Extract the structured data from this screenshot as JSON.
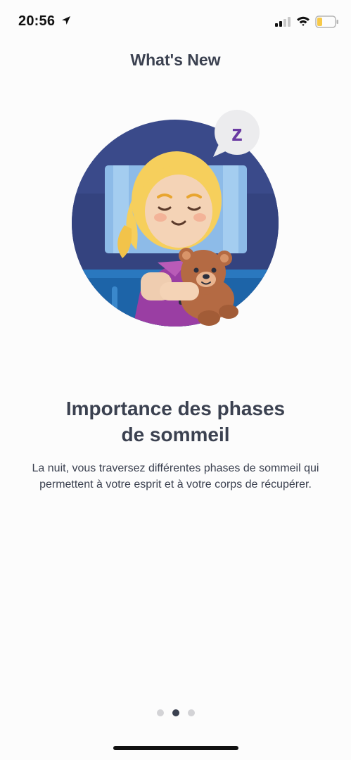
{
  "status_bar": {
    "time": "20:56",
    "icons": [
      "location-arrow-icon",
      "cellular-signal-icon",
      "wifi-icon",
      "battery-low-icon"
    ],
    "battery_color": "#f7c948"
  },
  "header": {
    "title": "What's New"
  },
  "illustration": {
    "subject": "sleeping-girl-with-teddy-bear",
    "badge_letter": "z",
    "colors": {
      "circle": "#3a4a8a",
      "badge": "#6a3aa2",
      "hair": "#f6cf5c",
      "shirt": "#9a3ea3",
      "bear": "#b46a43"
    }
  },
  "content": {
    "headline_line1": "Importance des phases",
    "headline_line2": "de sommeil",
    "description": "La nuit, vous traversez différentes phases de sommeil qui permettent à votre esprit et à votre corps de récupérer."
  },
  "pagination": {
    "total": 3,
    "active_index": 1
  }
}
